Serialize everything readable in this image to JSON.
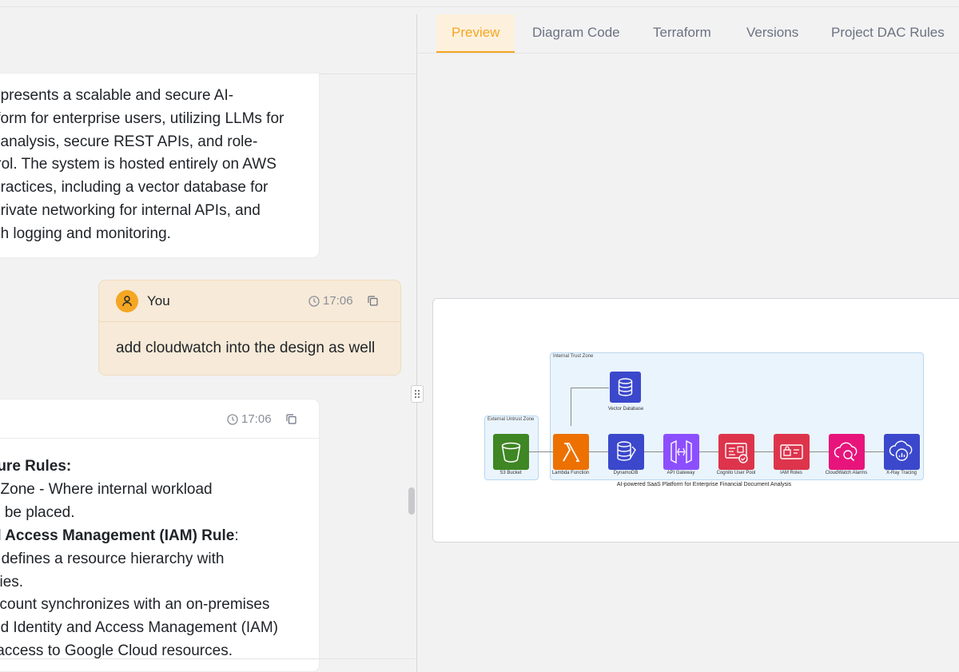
{
  "chat": {
    "message1_lines": [
      "epresents a scalable and secure AI-",
      "tform for enterprise users, utilizing LLMs for",
      "t analysis, secure REST APIs, and role-",
      "trol. The system is hosted entirely on AWS",
      "practices, including a vector database for",
      "orivate networking for internal APIs, and",
      "gh logging and monitoring."
    ],
    "user_message": {
      "author": "You",
      "time": "17:06",
      "text": "add cloudwatch into the design as well"
    },
    "reply": {
      "time": "17:06",
      "line1_bold": "ture Rules:",
      "line2": "t Zone - Where internal workload",
      "line3": "d be placed.",
      "line4_bold": "d Access Management (IAM) Rule",
      "line4_tail": ":",
      "line5": "r defines a resource hierarchy with",
      "line6": "cies.",
      "line7": "ccount synchronizes with an on-premises",
      "line8": "nd Identity and Access Management (IAM)",
      "line9": " access to Google Cloud resources."
    }
  },
  "tabs": [
    "Preview",
    "Diagram Code",
    "Terraform",
    "Versions",
    "Project DAC Rules"
  ],
  "active_tab": "Preview",
  "diagram": {
    "internal_zone_label": "Internal Trust Zone",
    "external_zone_label": "External Untrust Zone",
    "vector_db_label": "Vector Database",
    "nodes": [
      {
        "label": "S3 Bucket",
        "color": "#3f8624"
      },
      {
        "label": "Lambda Function",
        "color": "#ed7100"
      },
      {
        "label": "DynamoDB",
        "color": "#3b48cc"
      },
      {
        "label": "API Gateway",
        "color": "#8c4fff"
      },
      {
        "label": "Cognito User Pool",
        "color": "#dd344c"
      },
      {
        "label": "IAM Roles",
        "color": "#dd344c"
      },
      {
        "label": "CloudWatch Alarms",
        "color": "#e7157b"
      },
      {
        "label": "X-Ray Tracing",
        "color": "#3b48cc"
      }
    ],
    "caption": "AI-powered SaaS Platform for Enterprise Financial Document Analysis"
  }
}
